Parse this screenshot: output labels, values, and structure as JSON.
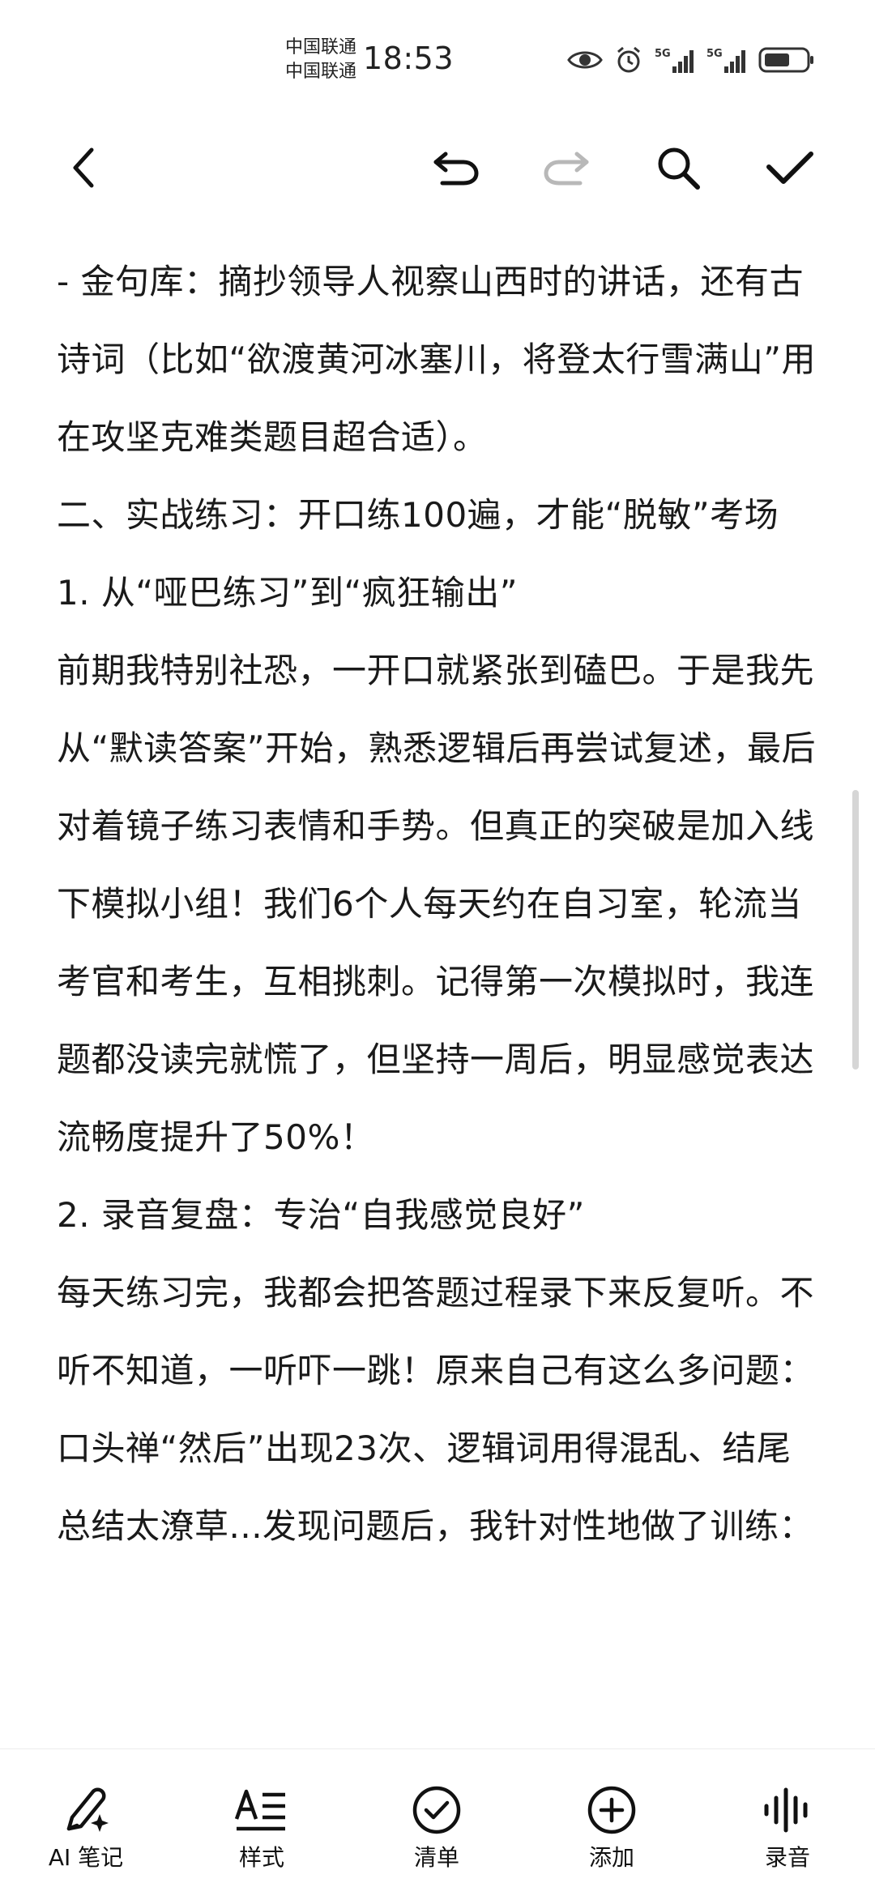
{
  "status_bar": {
    "carrier_1": "中国联通",
    "carrier_2": "中国联通",
    "time": "18:53",
    "signal_1_label": "5G",
    "signal_2_label": "5G",
    "icons": [
      "eye-icon",
      "alarm-icon",
      "signal-icon",
      "signal-icon",
      "battery-icon"
    ]
  },
  "toolbar": {
    "icons": [
      "back-icon",
      "undo-icon",
      "redo-icon",
      "search-icon",
      "check-icon"
    ],
    "redo_enabled": false
  },
  "content": {
    "paragraphs": [
      "- 金句库：摘抄领导人视察山西时的讲话，还有古诗词（比如“欲渡黄河冰塞川，将登太行雪满山”用在攻坚克难类题目超合适）。",
      "二、实战练习：开口练100遍，才能“脱敏”考场",
      "1. 从“哑巴练习”到“疯狂输出”",
      "前期我特别社恐，一开口就紧张到磕巴。于是我先从“默读答案”开始，熟悉逻辑后再尝试复述，最后对着镜子练习表情和手势。但真正的突破是加入线下模拟小组！我们6个人每天约在自习室，轮流当考官和考生，互相挑刺。记得第一次模拟时，我连题都没读完就慌了，但坚持一周后，明显感觉表达流畅度提升了50%！",
      "2. 录音复盘：专治“自我感觉良好”",
      "每天练习完，我都会把答题过程录下来反复听。不听不知道，一听吓一跳！原来自己有这么多问题：口头禅“然后”出现23次、逻辑词用得混乱、结尾总结太潦草...发现问题后，我针对性地做了训练："
    ]
  },
  "bottom_bar": {
    "items": [
      {
        "label": "AI 笔记",
        "icon": "ai-pen-icon"
      },
      {
        "label": "样式",
        "icon": "text-style-icon"
      },
      {
        "label": "清单",
        "icon": "checklist-icon"
      },
      {
        "label": "添加",
        "icon": "add-icon"
      },
      {
        "label": "录音",
        "icon": "audio-wave-icon"
      }
    ]
  },
  "colors": {
    "background": "#ffffff",
    "text": "#1a1a1a",
    "icon": "#111111",
    "disabled_icon": "#b8b8b8",
    "scroll_indicator": "#d6d6d6"
  }
}
